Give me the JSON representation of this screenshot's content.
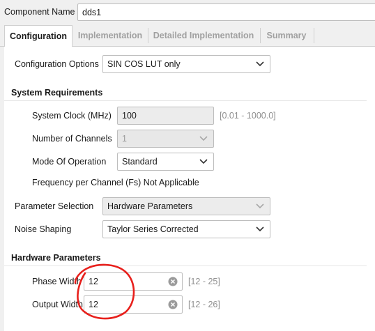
{
  "component": {
    "label": "Component Name",
    "value": "dds1"
  },
  "tabs": [
    {
      "label": "Configuration",
      "active": true
    },
    {
      "label": "Implementation",
      "active": false
    },
    {
      "label": "Detailed Implementation",
      "active": false
    },
    {
      "label": "Summary",
      "active": false
    }
  ],
  "config_options": {
    "label": "Configuration Options",
    "value": "SIN COS LUT only"
  },
  "system_requirements": {
    "header": "System Requirements",
    "clock": {
      "label": "System Clock (MHz)",
      "value": "100",
      "range": "[0.01 - 1000.0]"
    },
    "channels": {
      "label": "Number of Channels",
      "value": "1"
    },
    "mode": {
      "label": "Mode Of Operation",
      "value": "Standard"
    },
    "freq_note": "Frequency per Channel (Fs) Not Applicable"
  },
  "parameter_selection": {
    "label": "Parameter Selection",
    "value": "Hardware Parameters"
  },
  "noise_shaping": {
    "label": "Noise Shaping",
    "value": "Taylor Series Corrected"
  },
  "hardware_parameters": {
    "header": "Hardware Parameters",
    "phase_width": {
      "label": "Phase Width",
      "value": "12",
      "range": "[12 - 25]"
    },
    "output_width": {
      "label": "Output Width",
      "value": "12",
      "range": "[12 - 26]"
    }
  },
  "colors": {
    "annotation": "#e8201c",
    "panel": "#ffffff",
    "background": "#f0f0f0"
  },
  "icons": {
    "dropdown": "chevron-down-icon",
    "clear": "clear-circle-x-icon"
  }
}
